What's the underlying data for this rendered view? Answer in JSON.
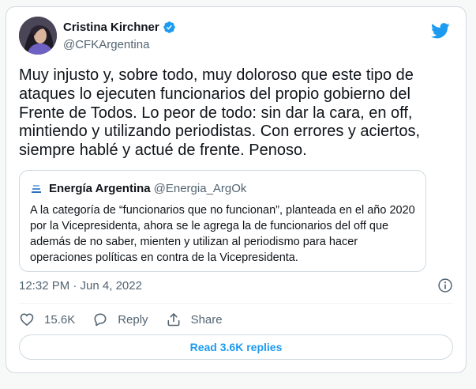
{
  "author": {
    "name": "Cristina Kirchner",
    "handle": "@CFKArgentina",
    "verified": true,
    "avatar_icon": "avatar-photo"
  },
  "tweet": {
    "text": "Muy injusto y, sobre todo, muy doloroso que este tipo de ataques lo ejecuten funcionarios del propio gobierno del Frente de Todos. Lo peor de todo: sin dar la cara, en off, mintiendo y utilizando periodistas. Con errores y aciertos, siempre hablé y actué de frente. Penoso.",
    "timestamp": "12:32 PM · Jun 4, 2022"
  },
  "quote": {
    "name": "Energía Argentina",
    "handle": "@Energia_ArgOk",
    "text": "A la categoría de “funcionarios que no funcionan”, planteada en el año 2020 por la Vicepresidenta, ahora se le agrega la de funcionarios del off que además de no saber, mienten y utilizan al periodismo para hacer operaciones políticas en contra de la Vicepresidenta."
  },
  "actions": {
    "like_count": "15.6K",
    "reply_label": "Reply",
    "share_label": "Share"
  },
  "read_replies_label": "Read 3.6K replies",
  "colors": {
    "accent": "#1d9bf0",
    "text": "#0f1419",
    "secondary": "#536471",
    "border": "#cfd9de"
  },
  "icons": [
    "verified-badge-icon",
    "twitter-bird-icon",
    "info-icon",
    "heart-icon",
    "reply-icon",
    "share-icon"
  ]
}
